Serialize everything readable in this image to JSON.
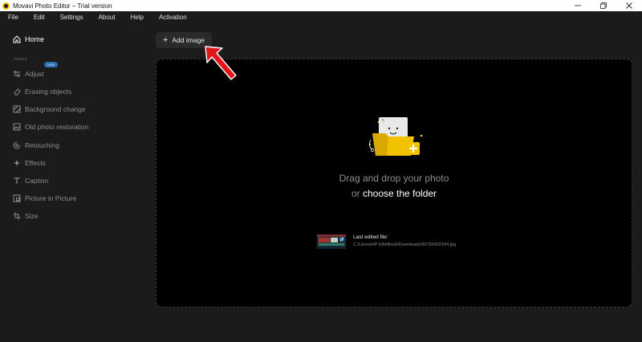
{
  "window": {
    "title": "Movavi Photo Editor – Trial version",
    "minimize_icon": "minimize-icon",
    "maximize_icon": "restore-icon",
    "close_icon": "close-icon"
  },
  "menu": [
    "File",
    "Edit",
    "Settings",
    "About",
    "Help",
    "Activation"
  ],
  "sidebar": {
    "home_label": "Home",
    "tools_label": "TOOLS",
    "new_badge": "NEW",
    "tools": [
      {
        "label": "Adjust",
        "icon": "sliders-icon"
      },
      {
        "label": "Erasing objects",
        "icon": "eraser-icon"
      },
      {
        "label": "Background change",
        "icon": "background-icon"
      },
      {
        "label": "Old photo restoration",
        "icon": "photo-restore-icon"
      },
      {
        "label": "Retouching",
        "icon": "retouch-icon"
      },
      {
        "label": "Effects",
        "icon": "sparkle-icon"
      },
      {
        "label": "Caption",
        "icon": "text-icon"
      },
      {
        "label": "Picture in Picture",
        "icon": "pip-icon"
      },
      {
        "label": "Size",
        "icon": "crop-icon"
      }
    ]
  },
  "main": {
    "add_image_label": "Add image",
    "drag_text": "Drag and drop your photo",
    "or_text": "or",
    "choose_text": "choose the folder",
    "last_edited_label": "Last edited file:",
    "last_edited_path": "C:/Users/HP EliteBook/Downloads/93795492184.jpg"
  },
  "colors": {
    "accent_yellow": "#f2c200",
    "badge_blue": "#2b6fb3",
    "arrow_red": "#e0161b"
  }
}
